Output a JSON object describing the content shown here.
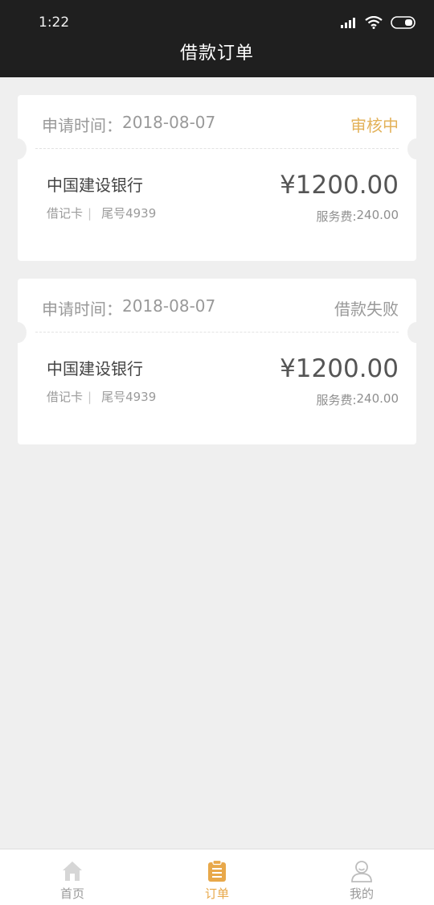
{
  "status_bar": {
    "time": "1:22"
  },
  "header": {
    "title": "借款订单"
  },
  "orders": [
    {
      "apply_label": "申请时间：",
      "apply_date": "2018-08-07",
      "status": "审核中",
      "bank_name": "中国建设银行",
      "card_type": "借记卡",
      "separator": "|",
      "card_tail": "尾号4939",
      "amount": "¥1200.00",
      "fee_label": "服务费:",
      "fee_value": "240.00"
    },
    {
      "apply_label": "申请时间：",
      "apply_date": "2018-08-07",
      "status": "借款失败",
      "bank_name": "中国建设银行",
      "card_type": "借记卡",
      "separator": "|",
      "card_tail": "尾号4939",
      "amount": "¥1200.00",
      "fee_label": "服务费:",
      "fee_value": "240.00"
    }
  ],
  "tabbar": {
    "items": [
      {
        "label": "首页",
        "icon": "home-icon"
      },
      {
        "label": "订单",
        "icon": "order-icon"
      },
      {
        "label": "我的",
        "icon": "user-icon"
      }
    ],
    "active_color": "#e8a84a",
    "inactive_color": "#999999"
  }
}
